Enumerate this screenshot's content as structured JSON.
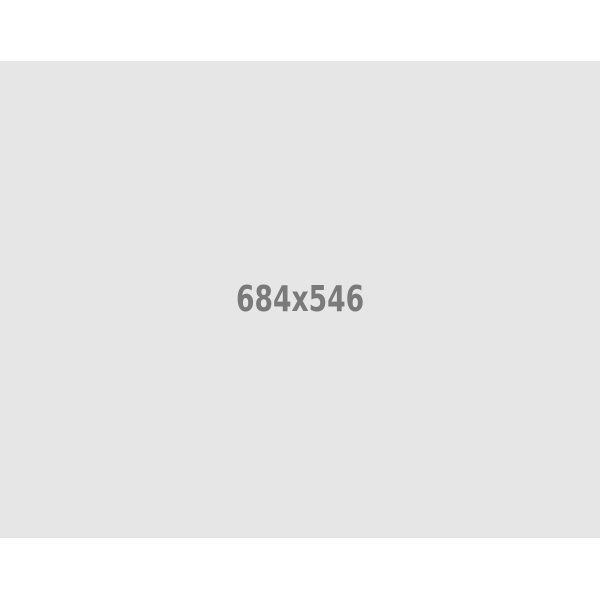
{
  "placeholder": {
    "label": "684x546",
    "background_color": "#e6e6e6",
    "text_color": "#7a7a7a"
  },
  "page": {
    "background_color": "#ffffff"
  }
}
